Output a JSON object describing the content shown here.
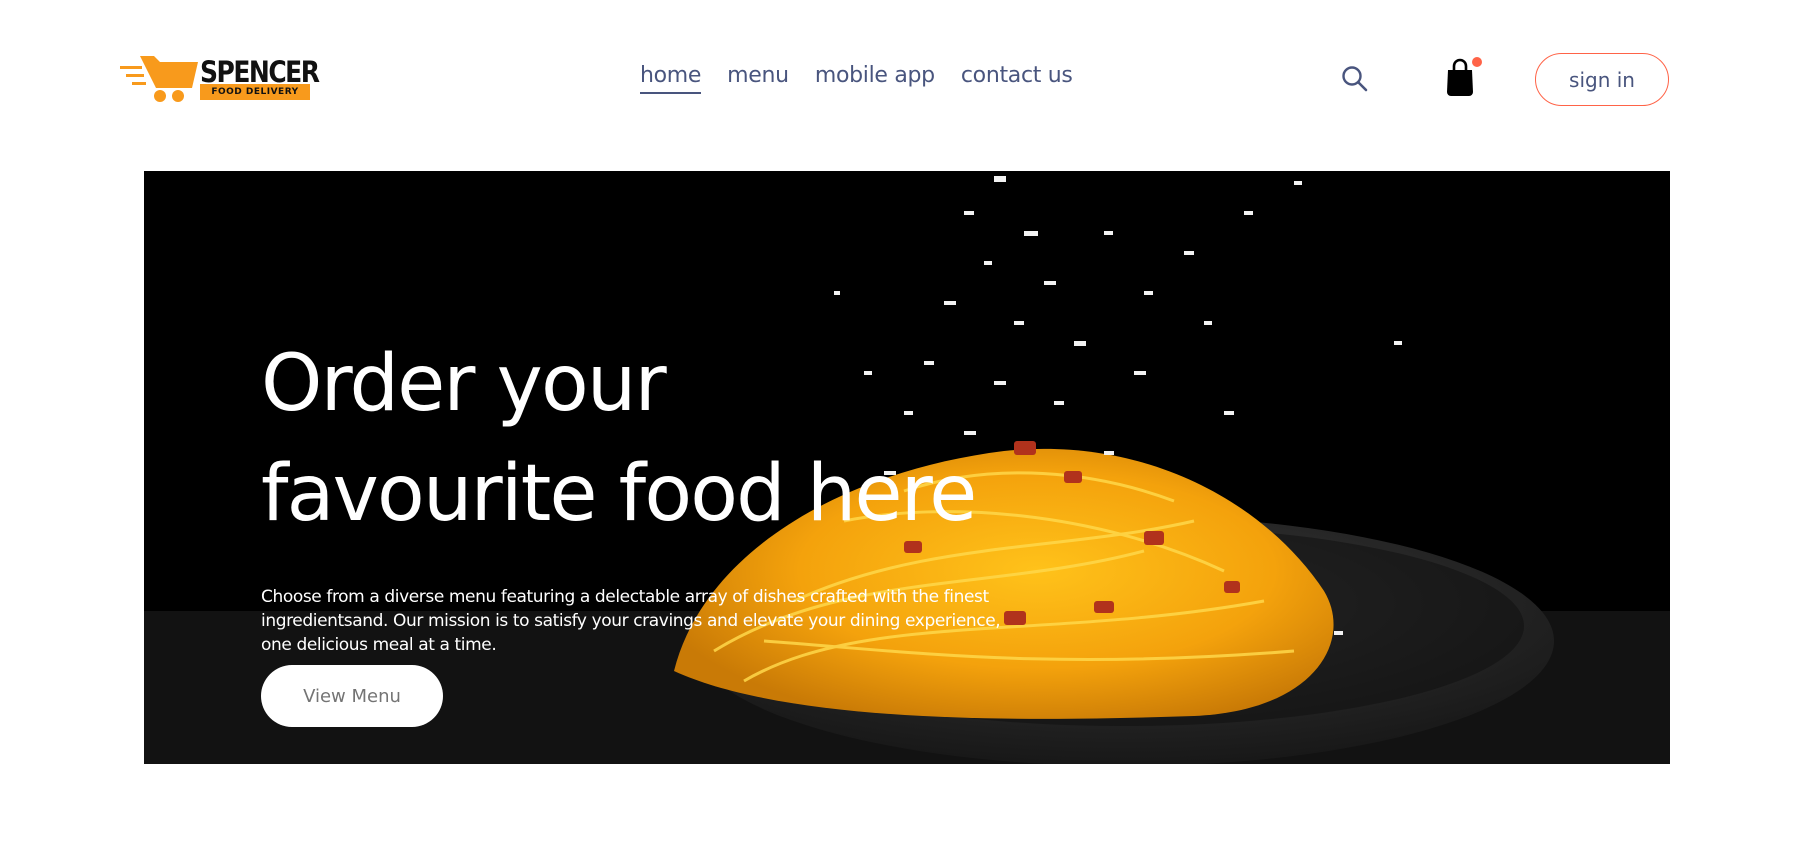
{
  "logo": {
    "icon": "delivery-cart-icon",
    "name": "SPENCER",
    "tagline": "FOOD DELIVERY",
    "colors": {
      "accent": "#f89a1c",
      "text": "#111111"
    }
  },
  "nav": {
    "items": [
      {
        "label": "home",
        "active": true
      },
      {
        "label": "menu",
        "active": false
      },
      {
        "label": "mobile app",
        "active": false
      },
      {
        "label": "contact us",
        "active": false
      }
    ],
    "search_icon": "search-icon",
    "cart_icon": "shopping-bag-icon",
    "cart_badge_color": "#ff6347",
    "signin_label": "sign in"
  },
  "hero": {
    "title": "Order your\nfavourite food here",
    "text": "Choose from a diverse menu featuring a delectable array of dishes crafted with the finest ingredientsand. Our mission is to satisfy your cravings and elevate your dining experience, one delicious meal at a time.",
    "button_label": "View Menu",
    "image": "pasta-dish-with-falling-cheese-image"
  },
  "colors": {
    "nav_text": "#49557e",
    "accent": "#ff6347",
    "hero_bg": "#000000",
    "button_text": "#747474"
  }
}
